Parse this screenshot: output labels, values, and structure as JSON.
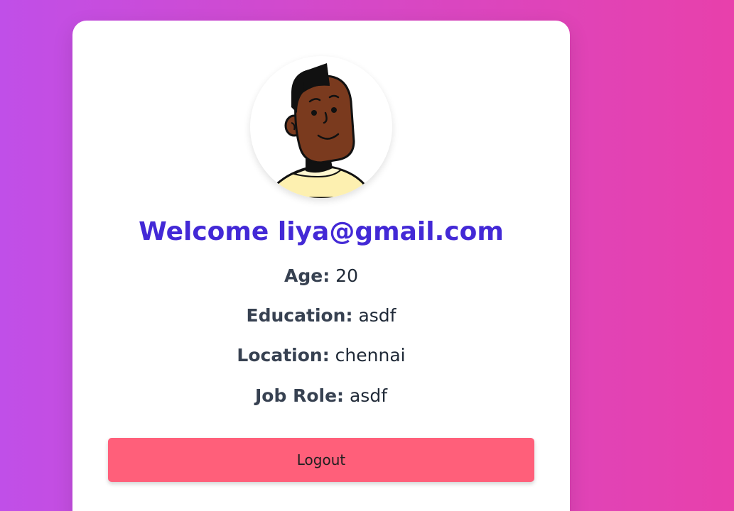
{
  "profile": {
    "welcome_prefix": "Welcome",
    "email": "liya@gmail.com",
    "fields": [
      {
        "label": "Age:",
        "value": "20"
      },
      {
        "label": "Education:",
        "value": "asdf"
      },
      {
        "label": "Location:",
        "value": "chennai"
      },
      {
        "label": "Job Role:",
        "value": "asdf"
      }
    ]
  },
  "actions": {
    "logout_label": "Logout"
  },
  "colors": {
    "background_start": "#c04fe8",
    "background_end": "#e840ab",
    "title": "#4329d6",
    "logout_button": "#ff5f7a"
  },
  "icons": {
    "avatar": "user-avatar-illustration"
  }
}
